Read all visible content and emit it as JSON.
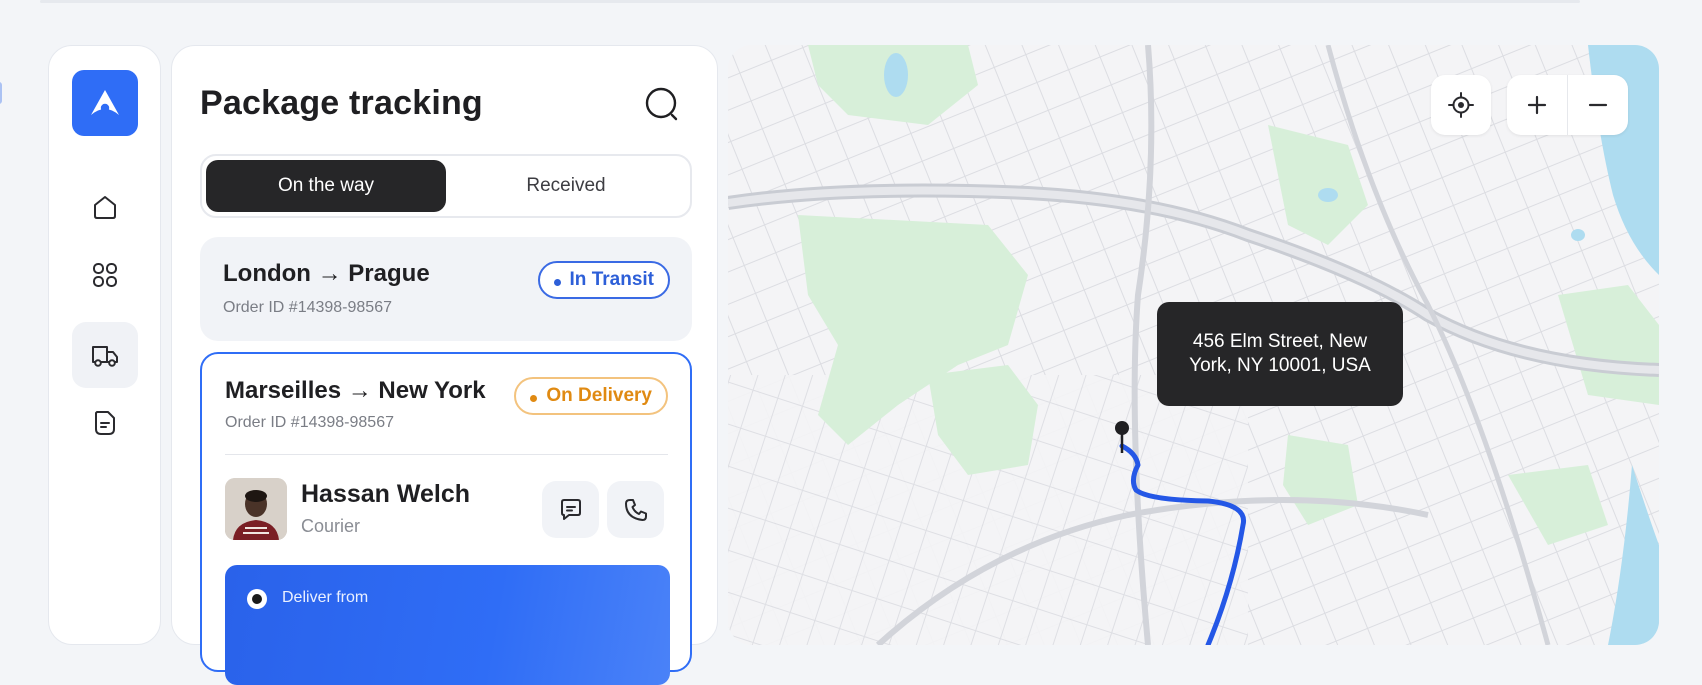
{
  "sidebar": {
    "logo": "app-logo",
    "items": [
      {
        "name": "home",
        "icon": "home-icon"
      },
      {
        "name": "apps",
        "icon": "grid-icon"
      },
      {
        "name": "delivery",
        "icon": "truck-icon",
        "active": true
      },
      {
        "name": "documents",
        "icon": "document-icon"
      }
    ]
  },
  "panel": {
    "title": "Package tracking",
    "tabs": [
      {
        "label": "On the way",
        "active": true
      },
      {
        "label": "Received",
        "active": false
      }
    ]
  },
  "shipments": [
    {
      "from": "London",
      "to": "Prague",
      "route": "London → Prague",
      "order_id": "Order ID #14398-98567",
      "status": "In Transit",
      "status_color": "#2d5fd8"
    },
    {
      "from": "Marseilles",
      "to": "New York",
      "route": "Marseilles → New York",
      "order_id": "Order ID #14398-98567",
      "status": "On Delivery",
      "status_color": "#e08a12",
      "courier": {
        "name": "Hassan Welch",
        "role": "Courier"
      },
      "deliver_from_label": "Deliver from"
    }
  ],
  "map": {
    "tooltip": "456 Elm Street, New York, NY 10001, USA",
    "controls": [
      "locate-icon",
      "zoom-in-icon",
      "zoom-out-icon"
    ],
    "route_color": "#2457e6"
  },
  "colors": {
    "accent": "#2f6df6",
    "dark": "#262628",
    "transit": "#2d5fd8",
    "delivery": "#e08a12"
  }
}
